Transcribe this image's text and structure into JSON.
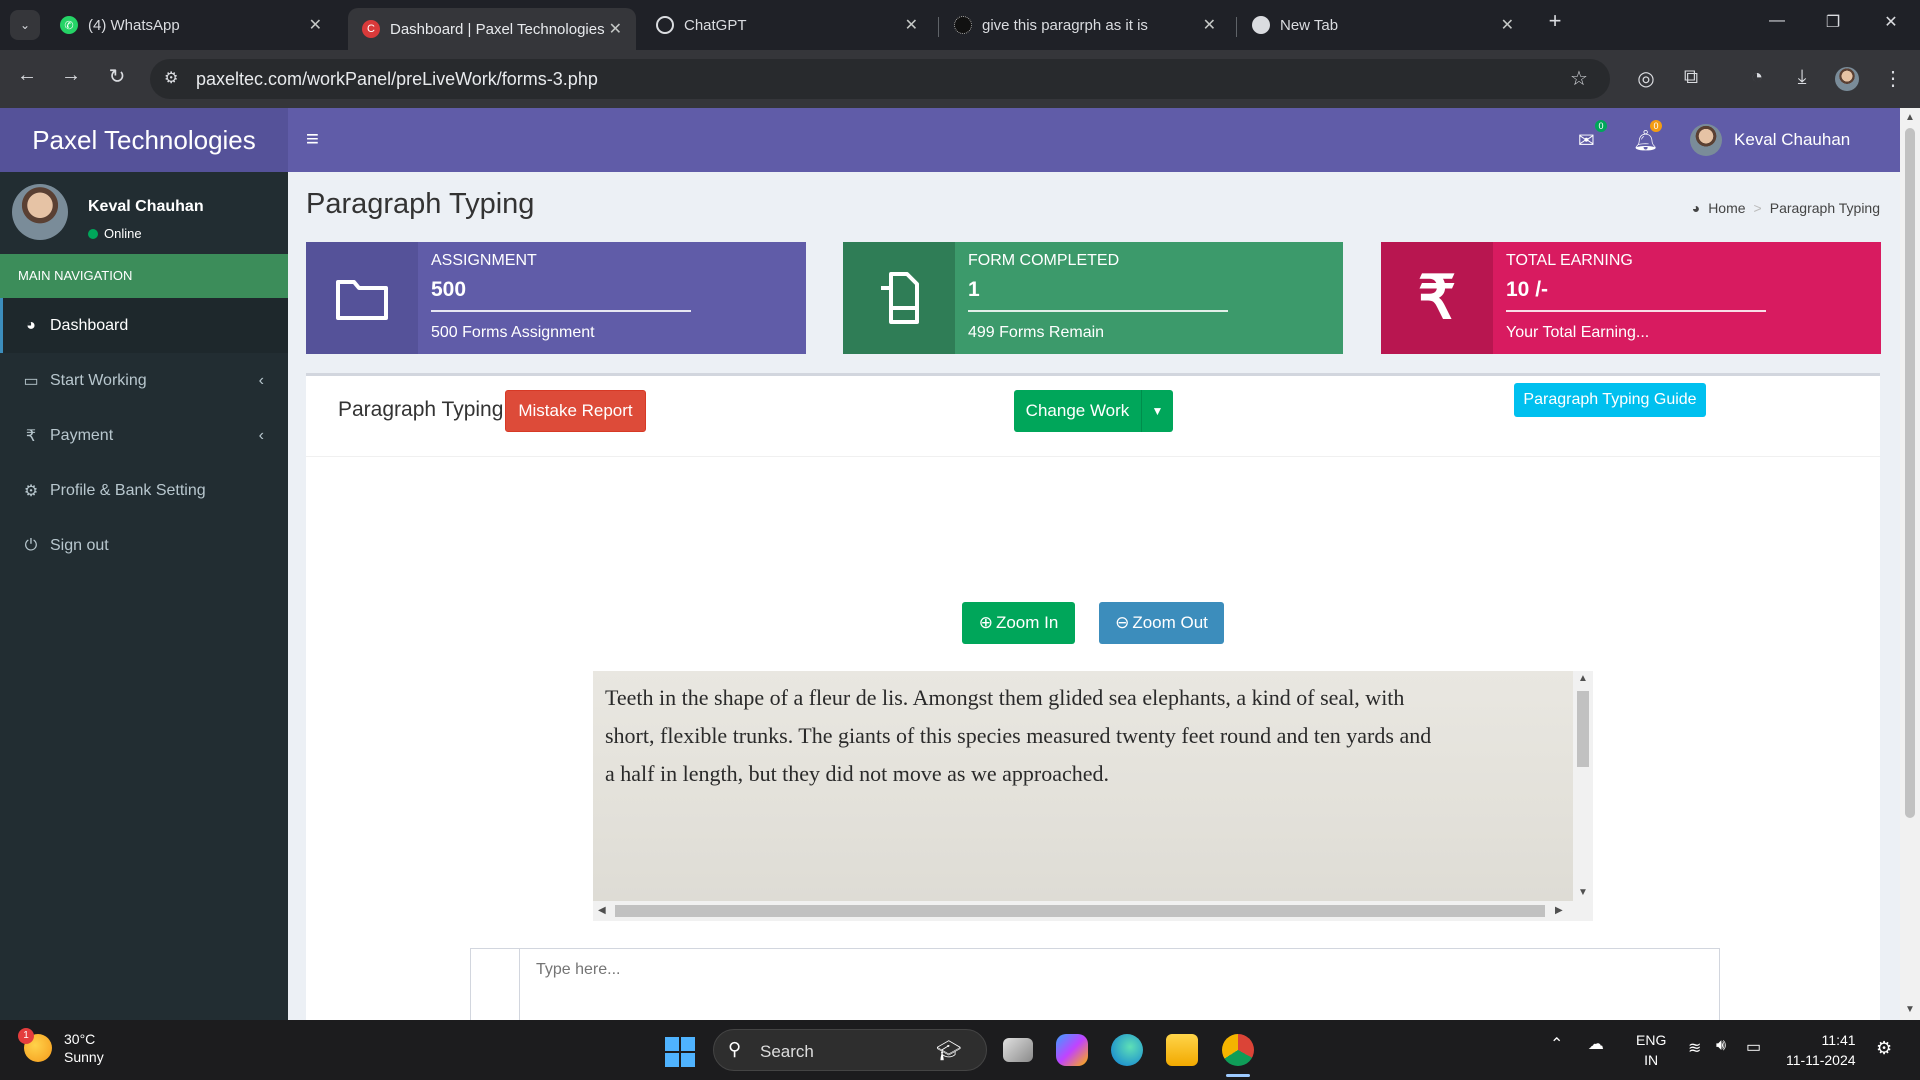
{
  "browser": {
    "tabs": [
      {
        "title": "(4) WhatsApp",
        "icon": "whatsapp-icon"
      },
      {
        "title": "Dashboard | Paxel Technologies",
        "icon": "paxel-icon",
        "active": true
      },
      {
        "title": "ChatGPT",
        "icon": "chatgpt-icon"
      },
      {
        "title": "give this paragrph as it is",
        "icon": "ai-chat-icon"
      },
      {
        "title": "New Tab",
        "icon": "chrome-icon"
      }
    ],
    "url": "paxeltec.com/workPanel/preLiveWork/forms-3.php"
  },
  "app": {
    "brand": "Paxel Technologies",
    "user_name": "Keval Chauhan",
    "status": "Online",
    "nav_header": "MAIN NAVIGATION",
    "nav": [
      {
        "label": "Dashboard",
        "icon": "dashboard-icon"
      },
      {
        "label": "Start Working",
        "icon": "monitor-icon"
      },
      {
        "label": "Payment",
        "icon": "rupee-icon"
      },
      {
        "label": "Profile & Bank Setting",
        "icon": "gears-icon"
      },
      {
        "label": "Sign out",
        "icon": "power-icon"
      }
    ],
    "mail_count": "0",
    "notif_count": "0"
  },
  "content": {
    "title": "Paragraph Typing",
    "breadcrumb": {
      "home": "Home",
      "current": "Paragraph Typing"
    },
    "info_boxes": [
      {
        "label": "ASSIGNMENT",
        "value": "500",
        "desc": "500 Forms Assignment",
        "color": "#555299",
        "icon_bg": "#4f4b8c"
      },
      {
        "label": "FORM COMPLETED",
        "value": "1",
        "desc": "499 Forms Remain",
        "color": "#3c9a6b",
        "icon_bg": "#2f7d56"
      },
      {
        "label": "TOTAL EARNING",
        "value": "10 /-",
        "desc": "Your Total Earning...",
        "color": "#d81b60",
        "icon_bg": "#b81650"
      }
    ],
    "box_title": "Paragraph Typing",
    "mistake_button": "Mistake Report",
    "change_work_button": "Change Work",
    "guide_button": "Paragraph Typing Guide",
    "zoom_in_button": "Zoom In",
    "zoom_out_button": "Zoom Out",
    "paragraph_lines": [
      "Teeth in the shape of a fleur de lis. Amongst them glided sea elephants, a kind of seal, with",
      "short, flexible trunks. The giants of this species measured twenty feet round and ten yards and",
      "a half in length, but they did not move as we approached."
    ],
    "type_placeholder": "Type here..."
  },
  "taskbar": {
    "weather_temp": "30°C",
    "weather_desc": "Sunny",
    "weather_badge": "1",
    "search_label": "Search",
    "lang_line1": "ENG",
    "lang_line2": "IN",
    "time": "11:41",
    "date": "11-11-2024"
  }
}
